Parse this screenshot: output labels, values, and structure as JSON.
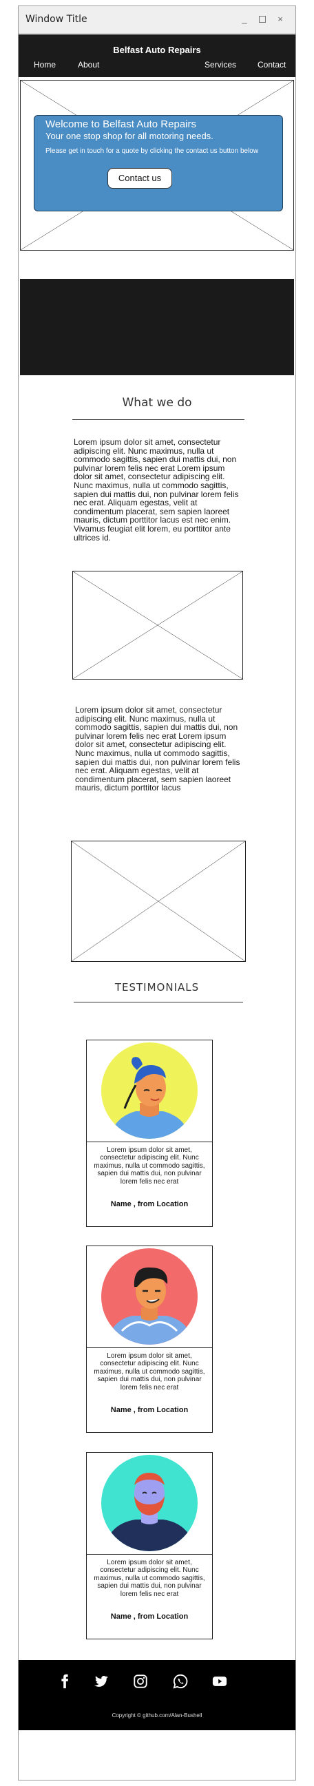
{
  "window": {
    "title": "Window Title",
    "minimize": "_",
    "close": "×"
  },
  "navbar": {
    "brand": "Belfast Auto Repairs",
    "links": [
      "Home",
      "About",
      "Services",
      "Contact"
    ]
  },
  "hero": {
    "title": "Welcome to Belfast Auto Repairs",
    "subtitle": "Your one stop shop for all motoring needs.",
    "text": "Please get in touch for a quote by clicking the contact us button below",
    "button": "Contact us",
    "card_color": "#4a8cc4"
  },
  "what_we_do": {
    "title": "What we do",
    "paragraph1": "Lorem ipsum dolor sit amet, consectetur adipiscing elit. Nunc maximus, nulla ut commodo sagittis, sapien dui mattis dui, non pulvinar lorem felis nec erat Lorem ipsum dolor sit amet, consectetur adipiscing elit. Nunc maximus, nulla ut commodo sagittis, sapien dui mattis dui, non pulvinar lorem felis nec erat. Aliquam egestas, velit at condimentum placerat, sem sapien laoreet mauris, dictum porttitor lacus est nec enim. Vivamus feugiat elit lorem, eu porttitor ante ultrices id.",
    "paragraph2": "Lorem ipsum dolor sit amet, consectetur adipiscing elit. Nunc maximus, nulla ut commodo sagittis, sapien dui mattis dui, non pulvinar lorem felis nec erat Lorem ipsum dolor sit amet, consectetur adipiscing elit. Nunc maximus, nulla ut commodo sagittis, sapien dui mattis dui, non pulvinar lorem felis nec erat. Aliquam egestas, velit at condimentum placerat, sem sapien laoreet mauris, dictum porttitor lacus"
  },
  "testimonials": {
    "title": "TESTIMONIALS",
    "items": [
      {
        "quote": "Lorem ipsum dolor sit amet, consectetur adipiscing elit. Nunc maximus, nulla ut commodo sagittis, sapien dui mattis dui, non pulvinar lorem felis nec erat",
        "name": "Name , from Location",
        "avatar": "woman-avatar-icon",
        "bg": "#f0f25a"
      },
      {
        "quote": "Lorem ipsum dolor sit amet, consectetur adipiscing elit. Nunc maximus, nulla ut commodo sagittis, sapien dui mattis dui, non pulvinar lorem felis nec erat",
        "name": "Name , from Location",
        "avatar": "man-avatar-icon",
        "bg": "#f26a6a"
      },
      {
        "quote": "Lorem ipsum dolor sit amet, consectetur adipiscing elit. Nunc maximus, nulla ut commodo sagittis, sapien dui mattis dui, non pulvinar lorem felis nec erat",
        "name": "Name , from Location",
        "avatar": "bearded-man-avatar-icon",
        "bg": "#3fe3cf"
      }
    ]
  },
  "footer": {
    "social": [
      "facebook-icon",
      "twitter-icon",
      "instagram-icon",
      "whatsapp-icon",
      "youtube-icon"
    ],
    "copyright": "Copyright © github.com/Alan-Bushell"
  }
}
